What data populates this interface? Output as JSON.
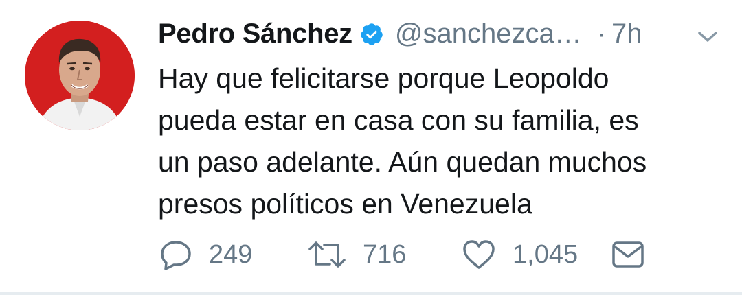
{
  "tweet": {
    "author_name": "Pedro Sánchez",
    "handle": "@sanchezca…",
    "time_separator": "·",
    "time": "7h",
    "text_lines": [
      "Hay que felicitarse porque Leopoldo",
      "pueda estar en casa con su familia, es",
      "un paso adelante. Aún quedan muchos",
      "presos políticos en Venezuela"
    ]
  },
  "actions": {
    "reply_count": "249",
    "retweet_count": "716",
    "like_count": "1,045"
  },
  "icons": {
    "verified": "verified-badge-icon",
    "menu": "chevron-down-icon",
    "reply": "reply-icon",
    "retweet": "retweet-icon",
    "like": "heart-icon",
    "message": "envelope-icon"
  },
  "colors": {
    "text": "#14171a",
    "secondary": "#657786",
    "verified": "#1da1f2",
    "avatar_bg": "#d31f1f"
  }
}
